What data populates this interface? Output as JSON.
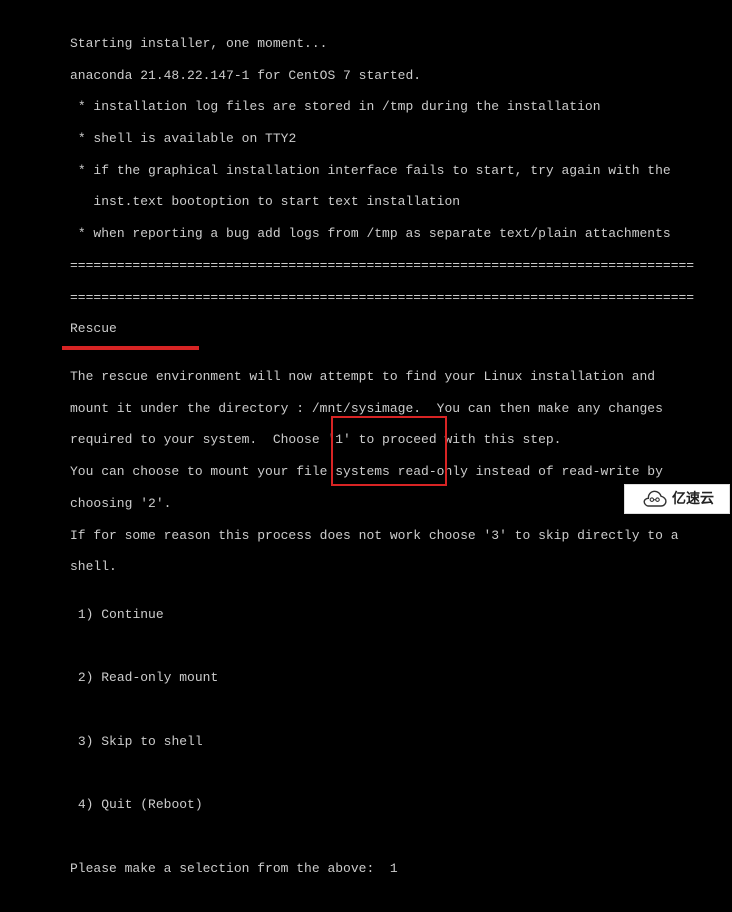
{
  "boot": {
    "lines": [
      "Starting installer, one moment...",
      "anaconda 21.48.22.147-1 for CentOS 7 started.",
      " * installation log files are stored in /tmp during the installation",
      " * shell is available on TTY2",
      " * if the graphical installation interface fails to start, try again with the",
      "   inst.text bootoption to start text installation",
      " * when reporting a bug add logs from /tmp as separate text/plain attachments",
      "================================================================================",
      "================================================================================"
    ]
  },
  "rescue": {
    "title": "Rescue",
    "body": [
      "",
      "The rescue environment will now attempt to find your Linux installation and",
      "mount it under the directory : /mnt/sysimage.  You can then make any changes",
      "required to your system.  Choose '1' to proceed with this step.",
      "You can choose to mount your file systems read-only instead of read-write by",
      "choosing '2'.",
      "If for some reason this process does not work choose '3' to skip directly to a",
      "shell.",
      ""
    ],
    "options": [
      {
        "key": "1",
        "label": "Continue"
      },
      {
        "key": "2",
        "label": "Read-only mount"
      },
      {
        "key": "3",
        "label": "Skip to shell"
      },
      {
        "key": "4",
        "label": "Quit (Reboot)"
      }
    ],
    "prompt": "Please make a selection from the above:  ",
    "input_value": "1"
  },
  "watermark": {
    "text": "亿速云"
  }
}
